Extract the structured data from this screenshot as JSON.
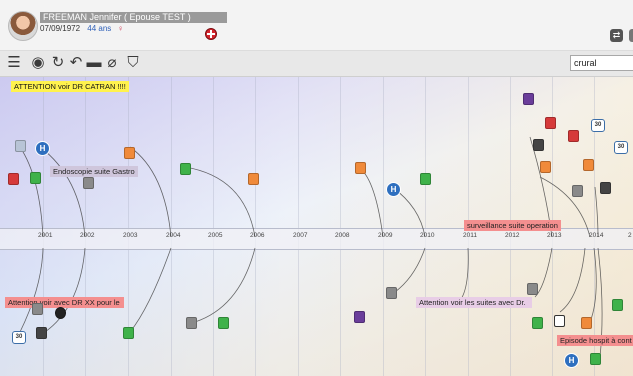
{
  "patient": {
    "name": "FREEMAN Jennifer ( Epouse TEST )",
    "birthdate": "07/09/1972",
    "age": "44 ans",
    "sex_symbol": "♀"
  },
  "toolbar": {
    "icons": [
      "menu-icon",
      "eye-icon",
      "refresh-icon",
      "undo-icon",
      "folder-icon",
      "tag-icon",
      "filter-icon"
    ],
    "search_value": "crural"
  },
  "timeline": {
    "years": [
      "2001",
      "2002",
      "2003",
      "2004",
      "2005",
      "2006",
      "2007",
      "2008",
      "2009",
      "2010",
      "2011",
      "2012",
      "2013",
      "2014",
      "2"
    ],
    "notes": [
      {
        "text": "ATTENTION voir DR CATRAN !!!!",
        "style": "yellow"
      },
      {
        "text": "Endoscopie suite Gastro",
        "style": "gray"
      },
      {
        "text": "surveillance suite operation",
        "style": "red"
      },
      {
        "text": "Attention voir avec DR XX pour le",
        "style": "red"
      },
      {
        "text": "Attention voir les suites avec Dr.",
        "style": "pink"
      },
      {
        "text": "Episode hospit à cont",
        "style": "red"
      }
    ],
    "event_labels": [
      "30",
      "30",
      "H",
      "H",
      "H",
      "30"
    ],
    "colors": {
      "event_green": "#3fb24a",
      "event_orange": "#f08a3a",
      "event_red": "#d63a3a",
      "event_gray": "#8a8a8a",
      "event_purple": "#6a3d9a",
      "hospital_blue": "#2e6fbf"
    }
  }
}
